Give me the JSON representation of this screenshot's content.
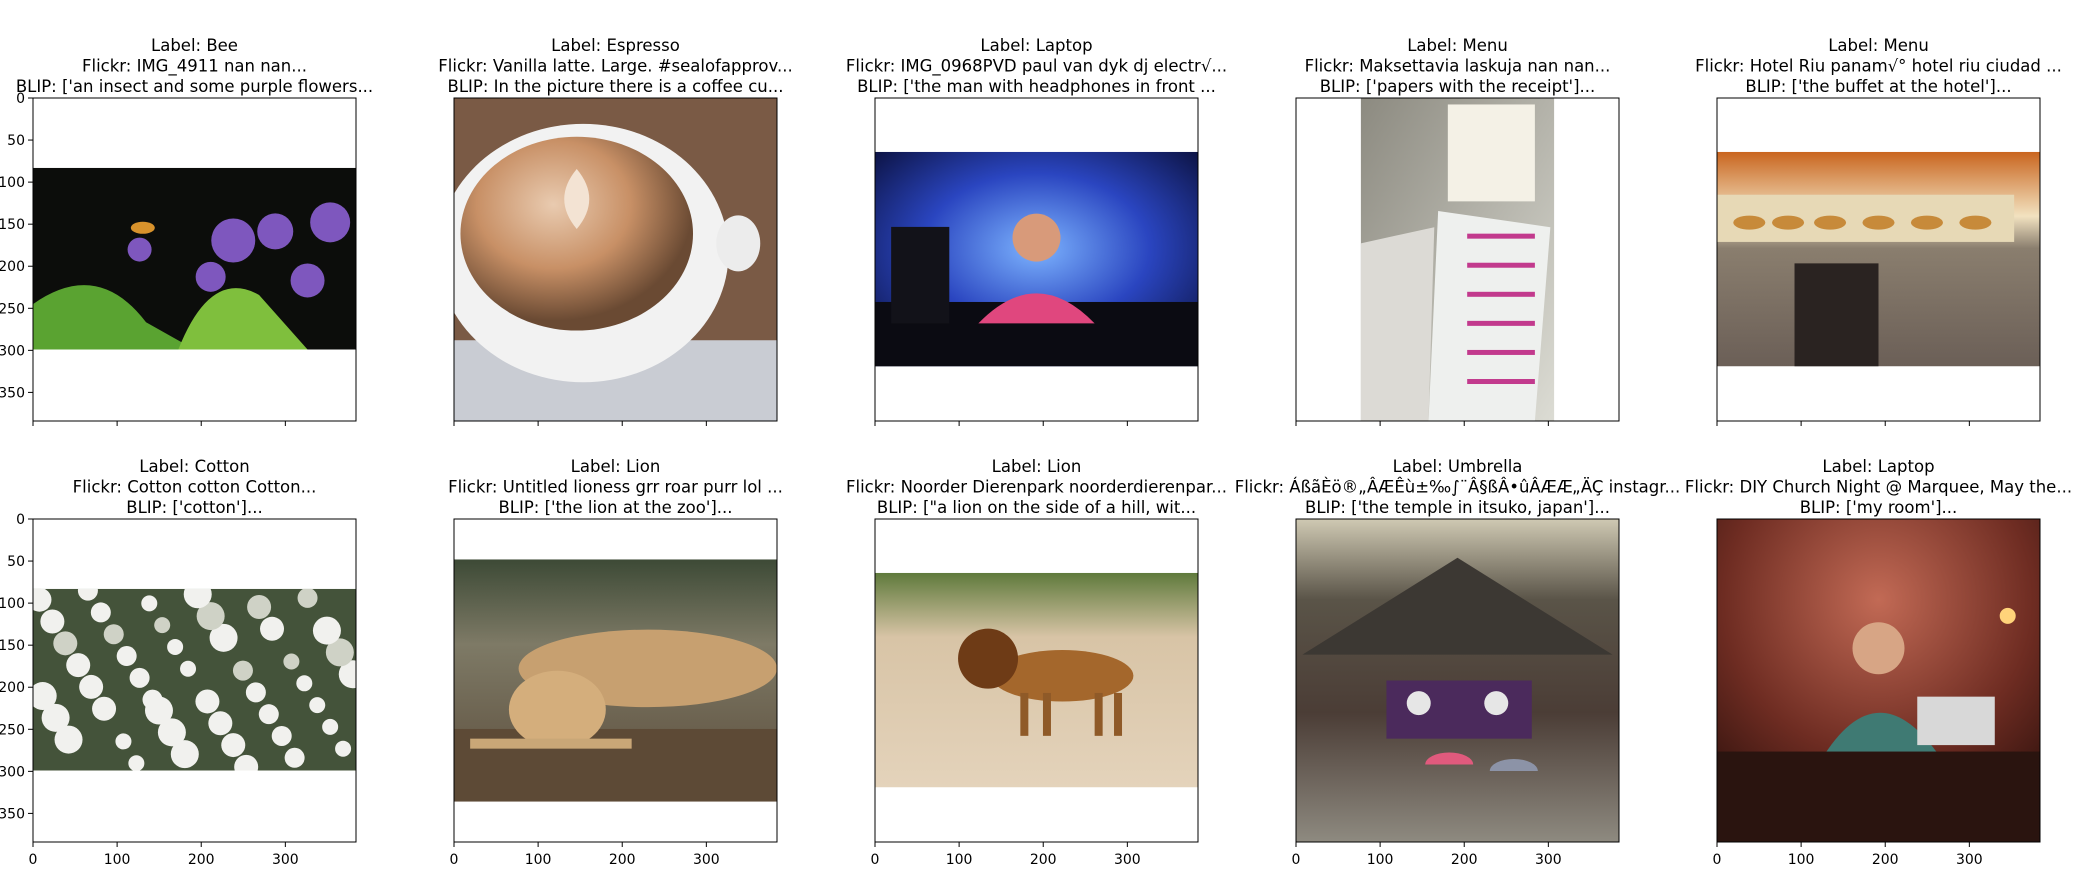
{
  "chart_data": {
    "type": "image-grid",
    "rows": 2,
    "cols": 5,
    "axis": {
      "xlim": [
        0,
        384
      ],
      "ylim": [
        384,
        0
      ],
      "xticks": [
        0,
        100,
        200,
        300
      ],
      "yticks": [
        0,
        50,
        100,
        150,
        200,
        250,
        300,
        350
      ],
      "x_tick_row": 2,
      "y_tick_col": 1
    },
    "panels": [
      {
        "label": "Label: Bee",
        "flickr": "Flickr: IMG_4911 nan nan...",
        "blip": "BLIP: ['an insect and some purple flowers...",
        "image_extent": [
          0,
          384,
          83,
          299
        ],
        "subject": "bee-and-purple-flowers"
      },
      {
        "label": "Label: Espresso",
        "flickr": "Flickr: Vanilla latte. Large. #sealofapprov...",
        "blip": "BLIP: In the picture there is a coffee cu...",
        "image_extent": [
          0,
          384,
          0,
          384
        ],
        "subject": "latte-art-cup"
      },
      {
        "label": "Label: Laptop",
        "flickr": "Flickr: IMG_0968PVD paul van dyk dj electr√...",
        "blip": "BLIP: ['the man with headphones in front ...",
        "image_extent": [
          0,
          384,
          64,
          319
        ],
        "subject": "dj-with-headphones"
      },
      {
        "label": "Label: Menu",
        "flickr": "Flickr: Maksettavia laskuja nan nan...",
        "blip": "BLIP: ['papers with the receipt']...",
        "image_extent": [
          77,
          307,
          0,
          384
        ],
        "subject": "papers-and-receipts"
      },
      {
        "label": "Label: Menu",
        "flickr": "Flickr: Hotel Riu panam√° hotel riu ciudad ...",
        "blip": "BLIP: ['the buffet at the hotel']...",
        "image_extent": [
          0,
          384,
          64,
          319
        ],
        "subject": "hotel-buffet"
      },
      {
        "label": "Label: Cotton",
        "flickr": "Flickr: Cotton cotton Cotton...",
        "blip": "BLIP: ['cotton']...",
        "image_extent": [
          0,
          384,
          83,
          299
        ],
        "subject": "cotton-bolls"
      },
      {
        "label": "Label: Lion",
        "flickr": "Flickr: Untitled lioness grr roar purr lol ...",
        "blip": "BLIP: ['the lion at the zoo']...",
        "image_extent": [
          0,
          384,
          48,
          336
        ],
        "subject": "lioness-resting"
      },
      {
        "label": "Label: Lion",
        "flickr": "Flickr: Noorder Dierenpark noorderdierenpar...",
        "blip": "BLIP: [\"a lion on the side of a hill, wit...",
        "image_extent": [
          0,
          384,
          64,
          319
        ],
        "subject": "lion-walking"
      },
      {
        "label": "Label: Umbrella",
        "flickr": "Flickr: ÁßãÈö®„ÂÆÊù±‰∫¨Â§ßÂ•ûÂÆÆ„ÄÇ instagr...",
        "blip": "BLIP: ['the temple in itsuko, japan']...",
        "image_extent": [
          0,
          384,
          0,
          384
        ],
        "subject": "japanese-shrine-umbrellas"
      },
      {
        "label": "Label: Laptop",
        "flickr": "Flickr: DIY Church Night @ Marquee, May the...",
        "blip": "BLIP: ['my room']...",
        "image_extent": [
          0,
          384,
          0,
          384
        ],
        "subject": "person-at-laptop-party"
      }
    ]
  }
}
